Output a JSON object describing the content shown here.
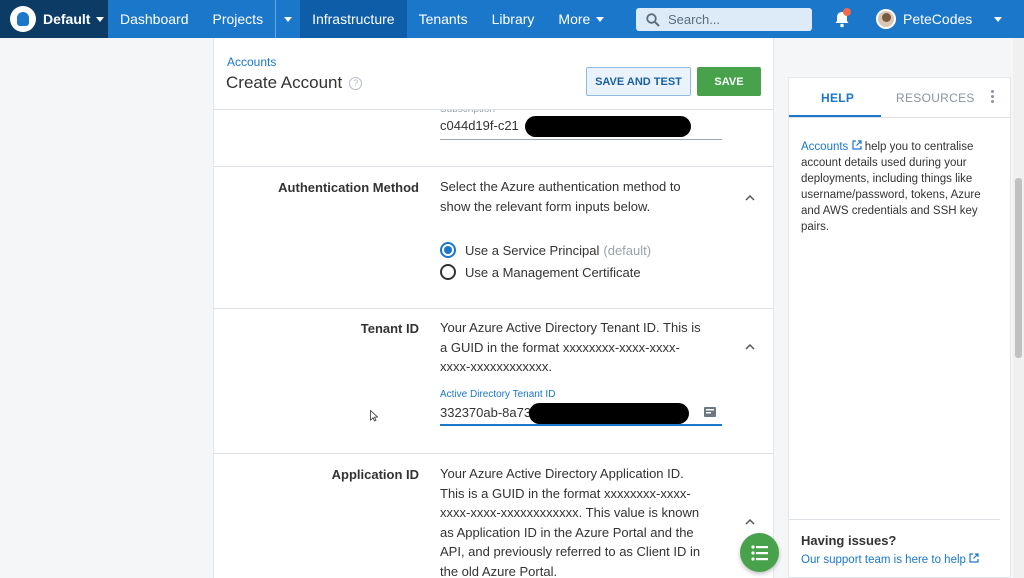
{
  "nav": {
    "space": "Default",
    "items": [
      "Dashboard",
      "Projects",
      "Infrastructure",
      "Tenants",
      "Library",
      "More"
    ],
    "search_placeholder": "Search...",
    "user": "PeteCodes",
    "accent": "#1a77ca"
  },
  "page": {
    "breadcrumb": "Accounts",
    "title": "Create Account",
    "save_test_label": "SAVE AND TEST",
    "save_label": "SAVE"
  },
  "subscription": {
    "label": "Subscription",
    "value": "c044d19f-c21"
  },
  "auth": {
    "label": "Authentication Method",
    "desc": "Select the Azure authentication method to show the relevant form inputs below.",
    "option1": "Use a Service Principal",
    "option1_note": "(default)",
    "option2": "Use a Management Certificate"
  },
  "tenant": {
    "label": "Tenant ID",
    "desc": "Your Azure Active Directory Tenant ID. This is a GUID in the format xxxxxxxx-xxxx-xxxx-xxxx-xxxxxxxxxxxx.",
    "field_label": "Active Directory Tenant ID",
    "value": "332370ab-8a73"
  },
  "application": {
    "label": "Application ID",
    "desc": "Your Azure Active Directory Application ID. This is a GUID in the format xxxxxxxx-xxxx-xxxx-xxxx-xxxxxxxxxxxx. This value is known as Application ID in the Azure Portal and the API, and previously referred to as Client ID in the old Azure Portal."
  },
  "help": {
    "tab_help": "HELP",
    "tab_resources": "RESOURCES",
    "link": "Accounts",
    "text": " help you to centralise account details used during your deployments, including things like username/password, tokens, Azure and AWS credentials and SSH key pairs.",
    "issues_title": "Having issues?",
    "issues_link": "Our support team is here to help"
  }
}
